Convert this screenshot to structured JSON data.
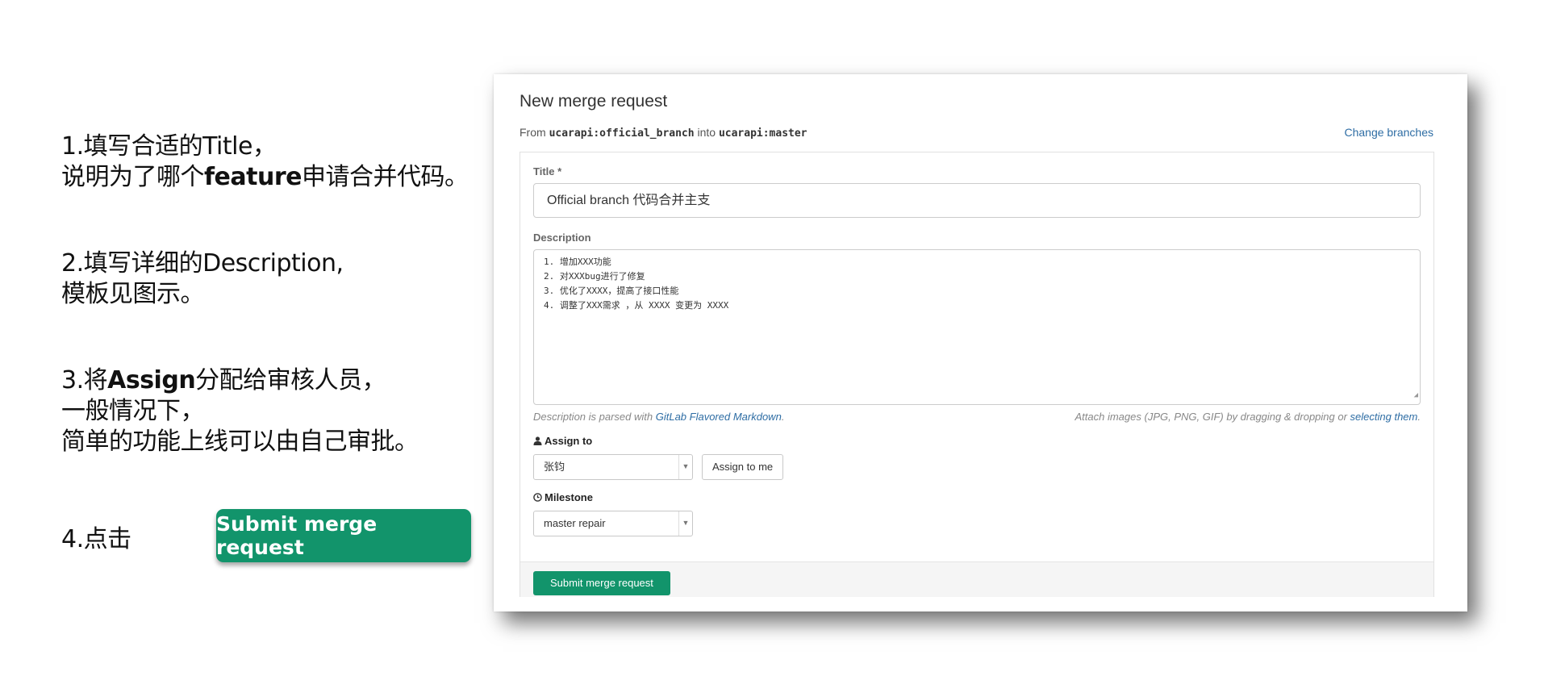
{
  "instructions": {
    "step1_line1": "1.填写合适的Title，",
    "step1_line2_pre": "说明为了哪个",
    "step1_line2_bold": "feature",
    "step1_line2_post": "申请合并代码。",
    "step2_line1": "2.填写详细的Description,",
    "step2_line2": "模板见图示。",
    "step3_line1_pre": "3.将",
    "step3_line1_bold": "Assign",
    "step3_line1_post": "分配给审核人员，",
    "step3_line2": "一般情况下，",
    "step3_line3": "简单的功能上线可以由自己审批。",
    "step4_label": "4.点击",
    "submit_button_label": "Submit merge request"
  },
  "merge_request": {
    "heading": "New merge request",
    "from_label": "From",
    "source_branch": "ucarapi:official_branch",
    "into_label": "into",
    "target_branch": "ucarapi:master",
    "change_branches": "Change branches",
    "title_label": "Title *",
    "title_value": "Official branch 代码合并主支",
    "description_label": "Description",
    "description_lines": [
      "1. 增加XXX功能",
      "2. 对XXXbug进行了修复",
      "3. 优化了XXXX，提高了接口性能",
      "4. 调整了XXX需求 ，从 XXXX 变更为 XXXX"
    ],
    "markdown_hint_pre": "Description is parsed with ",
    "markdown_hint_link": "GitLab Flavored Markdown",
    "markdown_hint_post": ".",
    "attach_hint_pre": "Attach images (JPG, PNG, GIF) by dragging & dropping or ",
    "attach_hint_link": "selecting them",
    "attach_hint_post": ".",
    "assign_label": "Assign to",
    "assignee_value": "张钧",
    "assign_to_me": "Assign to me",
    "milestone_label": "Milestone",
    "milestone_value": "master repair",
    "submit_label": "Submit merge request"
  },
  "colors": {
    "submit_green": "#12946b",
    "link_blue": "#2e6da4"
  }
}
